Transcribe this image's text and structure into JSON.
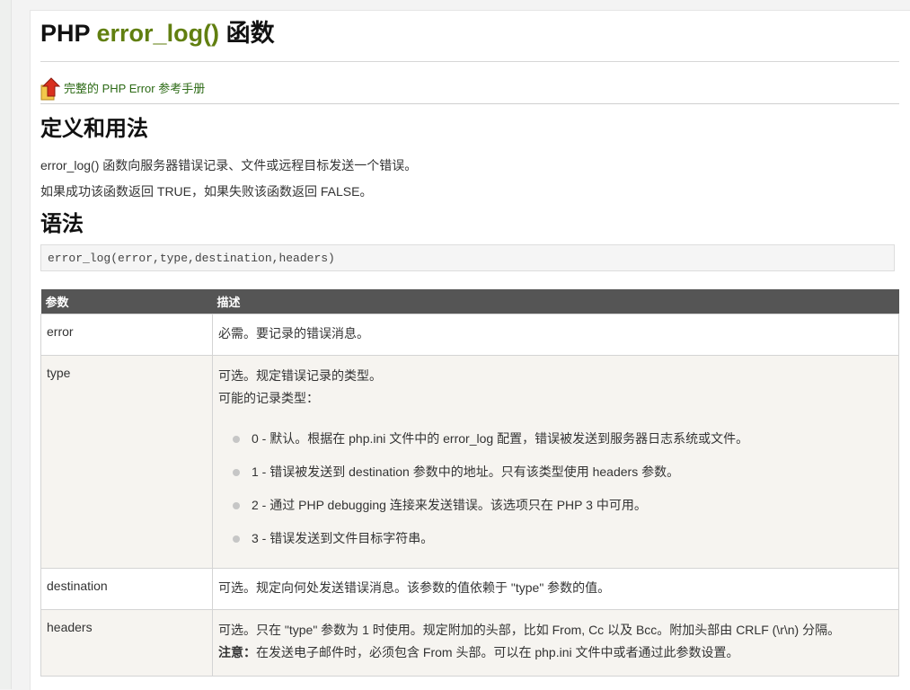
{
  "title": {
    "prefix": "PHP ",
    "function": "error_log()",
    "suffix": " 函数"
  },
  "back_link": {
    "label": "完整的 PHP Error 参考手册"
  },
  "sections": {
    "definition": {
      "heading": "定义和用法",
      "p1": "error_log() 函数向服务器错误记录、文件或远程目标发送一个错误。",
      "p2": "如果成功该函数返回 TRUE，如果失败该函数返回 FALSE。"
    },
    "syntax": {
      "heading": "语法",
      "code": "error_log(error,type,destination,headers)"
    }
  },
  "table": {
    "headers": [
      "参数",
      "描述"
    ],
    "rows": [
      {
        "name": "error",
        "desc": "必需。要记录的错误消息。"
      },
      {
        "name": "type",
        "desc": "可选。规定错误记录的类型。",
        "desc2": "可能的记录类型：",
        "items": [
          "0 - 默认。根据在 php.ini 文件中的 error_log 配置，错误被发送到服务器日志系统或文件。",
          "1 - 错误被发送到 destination 参数中的地址。只有该类型使用 headers 参数。",
          "2 - 通过 PHP debugging 连接来发送错误。该选项只在 PHP 3 中可用。",
          "3 - 错误发送到文件目标字符串。"
        ]
      },
      {
        "name": "destination",
        "desc": "可选。规定向何处发送错误消息。该参数的值依赖于 \"type\" 参数的值。"
      },
      {
        "name": "headers",
        "desc": "可选。只在 \"type\" 参数为 1 时使用。规定附加的头部，比如 From, Cc 以及 Bcc。附加头部由 CRLF (\\r\\n) 分隔。",
        "note_label": "注意：",
        "note": "在发送电子邮件时，必须包含 From 头部。可以在 php.ini 文件中或者通过此参数设置。"
      }
    ]
  },
  "colors": {
    "function_name": "#617f10",
    "link": "#2c6a15",
    "table_header": "#555555"
  },
  "icons": {
    "back": "arrow-up-folder-icon"
  }
}
